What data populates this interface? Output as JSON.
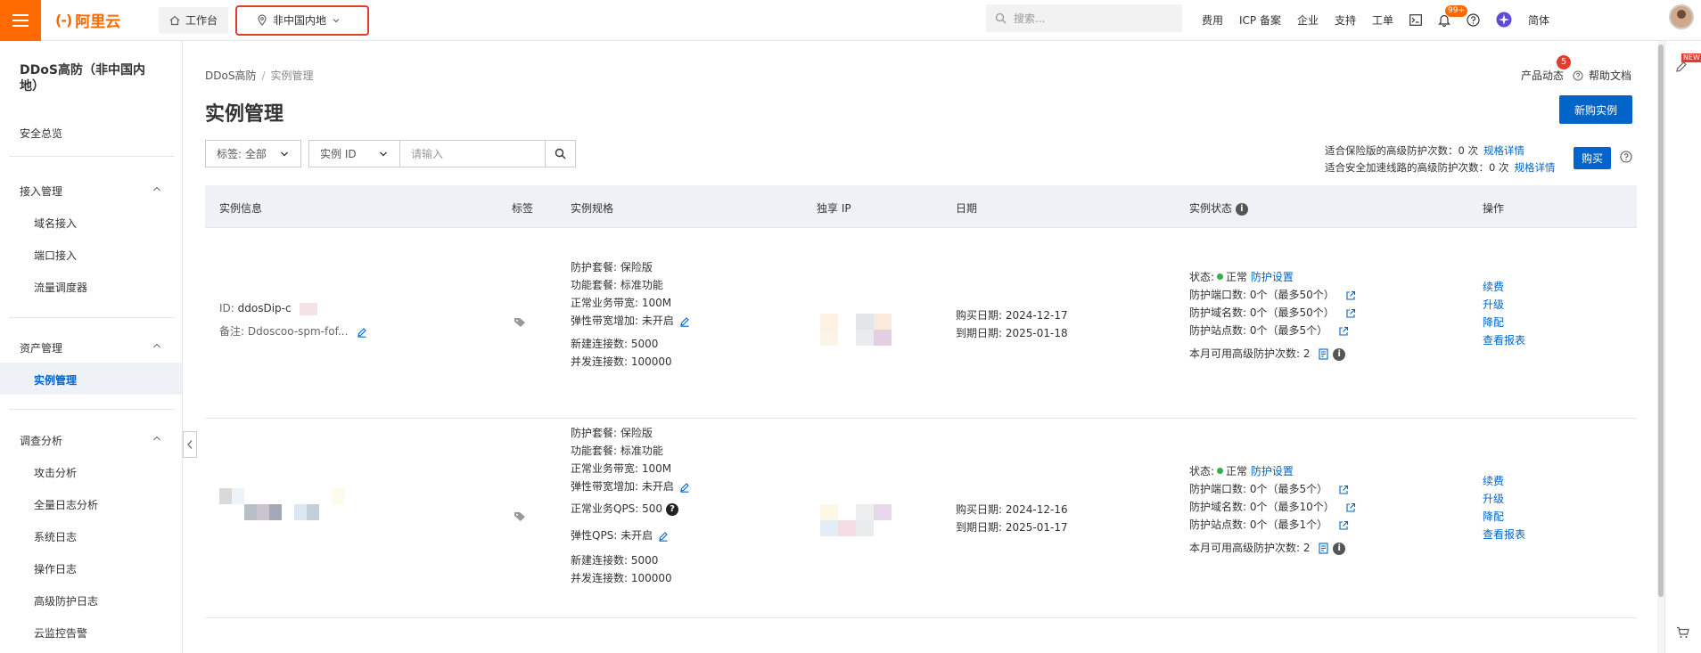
{
  "topbar": {
    "brand": "阿里云",
    "workspace": "工作台",
    "region": "非中国内地",
    "search_placeholder": "搜索...",
    "nav": [
      "费用",
      "ICP 备案",
      "企业",
      "支持",
      "工单"
    ],
    "notification_badge": "99+",
    "language": "简体"
  },
  "sidebar": {
    "title": "DDoS高防（非中国内地）",
    "overview": "安全总览",
    "groups": [
      {
        "label": "接入管理",
        "items": [
          "域名接入",
          "端口接入",
          "流量调度器"
        ]
      },
      {
        "label": "资产管理",
        "items": [
          "实例管理"
        ]
      },
      {
        "label": "调查分析",
        "items": [
          "攻击分析",
          "全量日志分析",
          "系统日志",
          "操作日志",
          "高级防护日志",
          "云监控告警"
        ]
      }
    ]
  },
  "main": {
    "breadcrumb": [
      "DDoS高防",
      "实例管理"
    ],
    "title": "实例管理",
    "product_news": "产品动态",
    "product_news_count": "5",
    "help_docs": "帮助文档",
    "new_button": "新购实例",
    "filter": {
      "tag_select": "标签: 全部",
      "field_select": "实例 ID",
      "input_placeholder": "请输入"
    },
    "quota": {
      "line1": "适合保险版的高级防护次数：0 次",
      "line2": "适合安全加速线路的高级防护次数：0 次",
      "spec_link": "规格详情",
      "buy": "购买"
    },
    "table": {
      "headers": [
        "实例信息",
        "标签",
        "实例规格",
        "独享 IP",
        "日期",
        "实例状态",
        "操作"
      ],
      "rows": [
        {
          "id_label": "ID:",
          "id_value": "ddosDip-c",
          "remark_label": "备注:",
          "remark_value": "Ddoscoo-spm-fof...",
          "specs": [
            "防护套餐: 保险版",
            "功能套餐: 标准功能",
            "正常业务带宽: 100M",
            "弹性带宽增加: 未开启",
            "新建连接数: 5000",
            "并发连接数: 100000"
          ],
          "buy_date": "购买日期: 2024-12-17",
          "expire_date": "到期日期: 2025-01-18",
          "status_label": "状态:",
          "status_value": "正常",
          "protect_settings": "防护设置",
          "ports": "防护端口数: 0个（最多50个）",
          "domains": "防护域名数: 0个（最多50个）",
          "sites": "防护站点数: 0个（最多5个）",
          "advanced": "本月可用高级防护次数: 2",
          "actions": [
            "续费",
            "升级",
            "降配",
            "查看报表"
          ]
        },
        {
          "specs": [
            "防护套餐: 保险版",
            "功能套餐: 标准功能",
            "正常业务带宽: 100M",
            "弹性带宽增加: 未开启",
            "正常业务QPS: 500",
            "弹性QPS: 未开启",
            "新建连接数: 5000",
            "并发连接数: 100000"
          ],
          "buy_date": "购买日期: 2024-12-16",
          "expire_date": "到期日期: 2025-01-17",
          "status_label": "状态:",
          "status_value": "正常",
          "protect_settings": "防护设置",
          "ports": "防护端口数: 0个（最多5个）",
          "domains": "防护域名数: 0个（最多10个）",
          "sites": "防护站点数: 0个（最多1个）",
          "advanced": "本月可用高级防护次数: 2",
          "actions": [
            "续费",
            "升级",
            "降配",
            "查看报表"
          ]
        }
      ]
    }
  },
  "rail": {
    "new_badge": "NEW"
  },
  "colors": {
    "brand": "#ff6a00",
    "primary": "#0064c8",
    "ok": "#2fb344",
    "alert": "#e03e2d"
  }
}
